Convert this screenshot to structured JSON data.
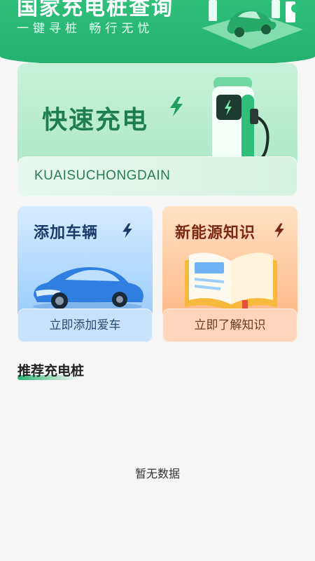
{
  "header": {
    "title": "国家充电桩查询",
    "subtitle": "一键寻桩 畅行无忧"
  },
  "fast_charge": {
    "title": "快速充电",
    "code": "KUAISUCHONGDAIN"
  },
  "cards": [
    {
      "title": "添加车辆",
      "button": "立即添加爱车"
    },
    {
      "title": "新能源知识",
      "button": "立即了解知识"
    }
  ],
  "recommend": {
    "title": "推荐充电桩",
    "empty_text": "暂无数据"
  },
  "colors": {
    "brand_green": "#23b070",
    "blue_card": "#8ec5fb",
    "orange_card": "#ffb07c"
  }
}
